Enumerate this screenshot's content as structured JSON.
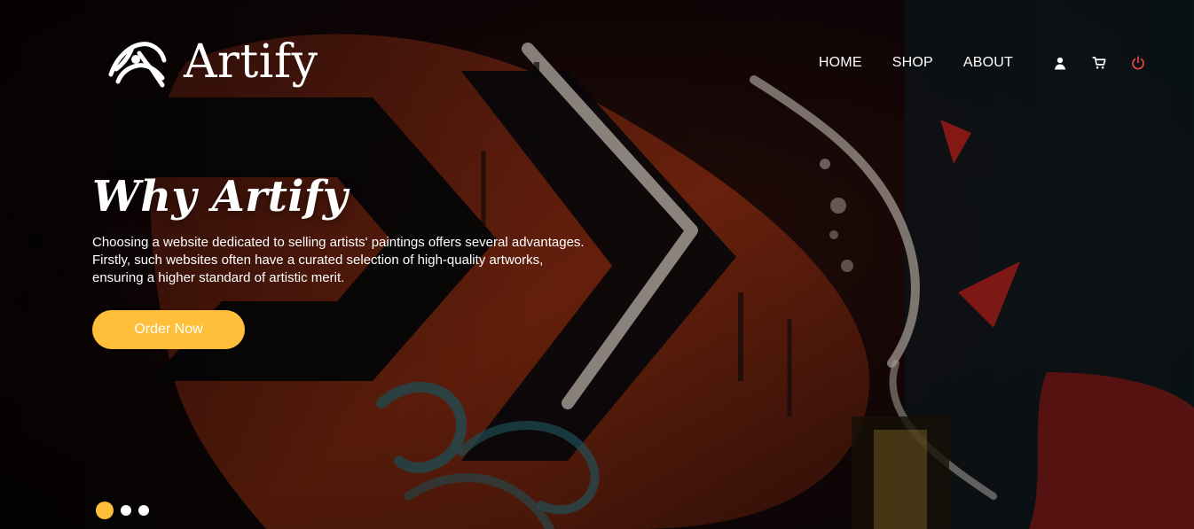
{
  "brand": {
    "name": "Artify"
  },
  "nav": {
    "items": [
      {
        "label": "HOME"
      },
      {
        "label": "SHOP"
      },
      {
        "label": "ABOUT"
      }
    ],
    "icons": [
      {
        "name": "user-icon"
      },
      {
        "name": "cart-icon"
      },
      {
        "name": "power-icon"
      }
    ]
  },
  "hero": {
    "title": "Why Artify",
    "description": "Choosing a website dedicated to selling artists' paintings offers several advantages. Firstly, such websites often have a curated selection of high-quality artworks, ensuring a higher standard of artistic merit.",
    "cta_label": "Order Now"
  },
  "carousel": {
    "count": 3,
    "active_index": 0
  },
  "colors": {
    "accent": "#ffbf3a",
    "power_icon": "#e2453c",
    "text": "#ffffff"
  }
}
